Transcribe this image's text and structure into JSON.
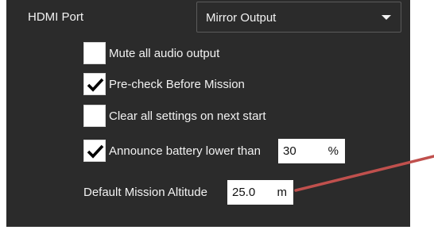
{
  "hdmi": {
    "label": "HDMI Port",
    "selected": "Mirror Output",
    "icon": "chevron-down-icon"
  },
  "options": [
    {
      "label": "Mute all audio output",
      "checked": false
    },
    {
      "label": "Pre-check Before Mission",
      "checked": true
    },
    {
      "label": "Clear all settings on next start",
      "checked": false
    },
    {
      "label": "Announce battery lower than",
      "checked": true
    }
  ],
  "battery": {
    "value": "30",
    "unit": "%"
  },
  "altitude": {
    "label": "Default Mission Altitude",
    "value": "25.0",
    "unit": "m"
  },
  "colors": {
    "panel_bg": "#2b2b2b",
    "text": "#f2f2f2",
    "annotation_arrow": "#c0504d"
  }
}
